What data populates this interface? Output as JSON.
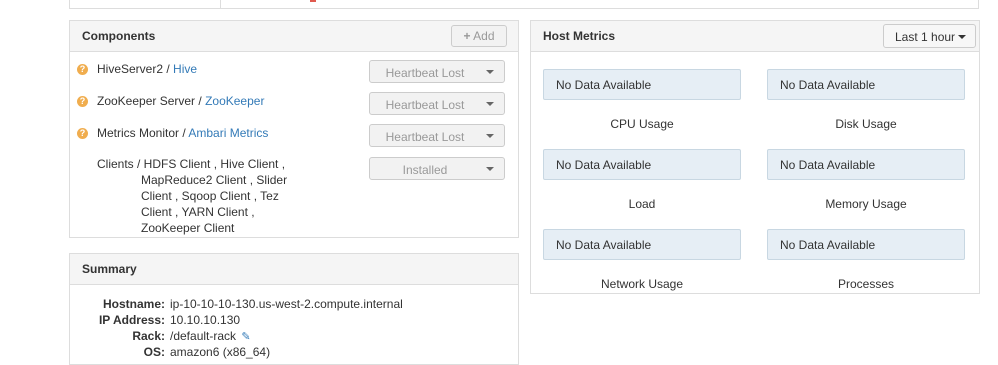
{
  "components": {
    "title": "Components",
    "add_label": "Add",
    "rows": [
      {
        "name": "HiveServer2",
        "service": "Hive",
        "status": "Heartbeat Lost"
      },
      {
        "name": "ZooKeeper Server",
        "service": "ZooKeeper",
        "status": "Heartbeat Lost"
      },
      {
        "name": "Metrics Monitor",
        "service": "Ambari Metrics",
        "status": "Heartbeat Lost"
      }
    ],
    "clients": {
      "lines": [
        "Clients / HDFS Client , Hive Client ,",
        "MapReduce2 Client , Slider",
        "Client , Sqoop Client , Tez",
        "Client , YARN Client ,",
        "ZooKeeper Client"
      ],
      "status": "Installed"
    }
  },
  "summary": {
    "title": "Summary",
    "rows": [
      {
        "key": "Hostname:",
        "value": "ip-10-10-10-130.us-west-2.compute.internal"
      },
      {
        "key": "IP Address:",
        "value": "10.10.10.130"
      },
      {
        "key": "Rack:",
        "value": "/default-rack"
      },
      {
        "key": "OS:",
        "value": "amazon6 (x86_64)"
      }
    ]
  },
  "host_metrics": {
    "title": "Host Metrics",
    "time_range": "Last 1 hour",
    "no_data": "No Data Available",
    "metrics": [
      "CPU Usage",
      "Disk Usage",
      "Load",
      "Memory Usage",
      "Network Usage",
      "Processes"
    ]
  }
}
